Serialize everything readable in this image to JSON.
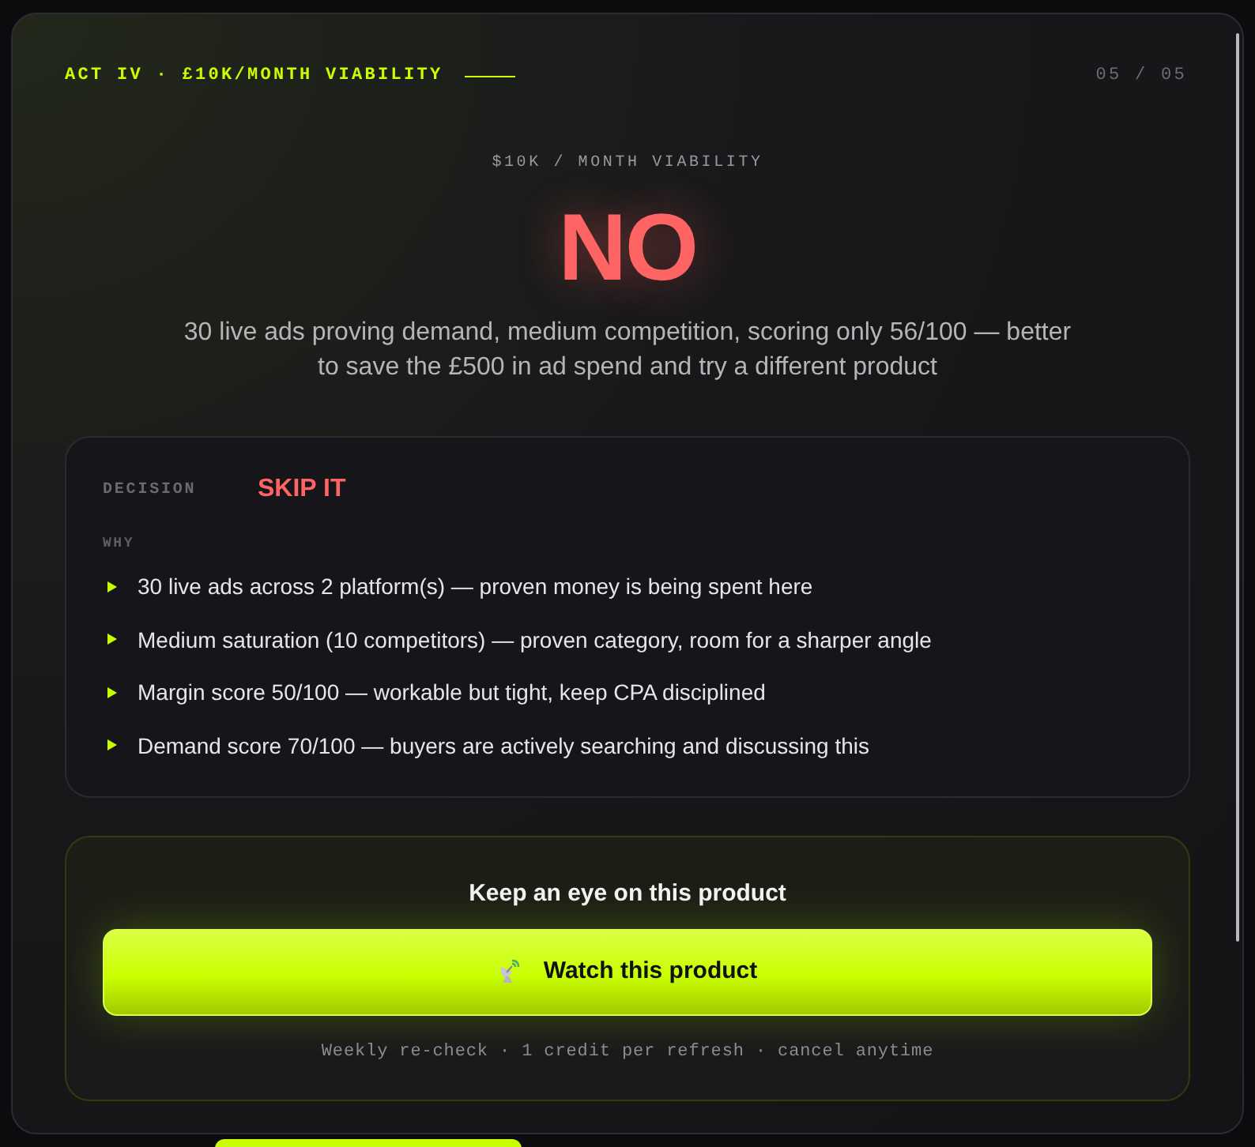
{
  "header": {
    "eyebrow": "ACT IV · £10K/MONTH VIABILITY",
    "step": "05 / 05"
  },
  "verdict": {
    "label": "$10K / MONTH VIABILITY",
    "answer": "NO",
    "summary": "30 live ads proving demand, medium competition, scoring only 56/100 — better to save the £500 in ad spend and try a different product"
  },
  "decision": {
    "label": "DECISION",
    "value": "SKIP IT",
    "why_label": "WHY",
    "reasons": [
      "30 live ads across 2 platform(s) — proven money is being spent here",
      "Medium saturation (10 competitors) — proven category, room for a sharper angle",
      "Margin score 50/100 — workable but tight, keep CPA disciplined",
      "Demand score 70/100 — buyers are actively searching and discussing this"
    ]
  },
  "watch": {
    "title": "Keep an eye on this product",
    "button": "Watch this product",
    "note": "Weekly re-check · 1 credit per refresh · cancel anytime"
  }
}
